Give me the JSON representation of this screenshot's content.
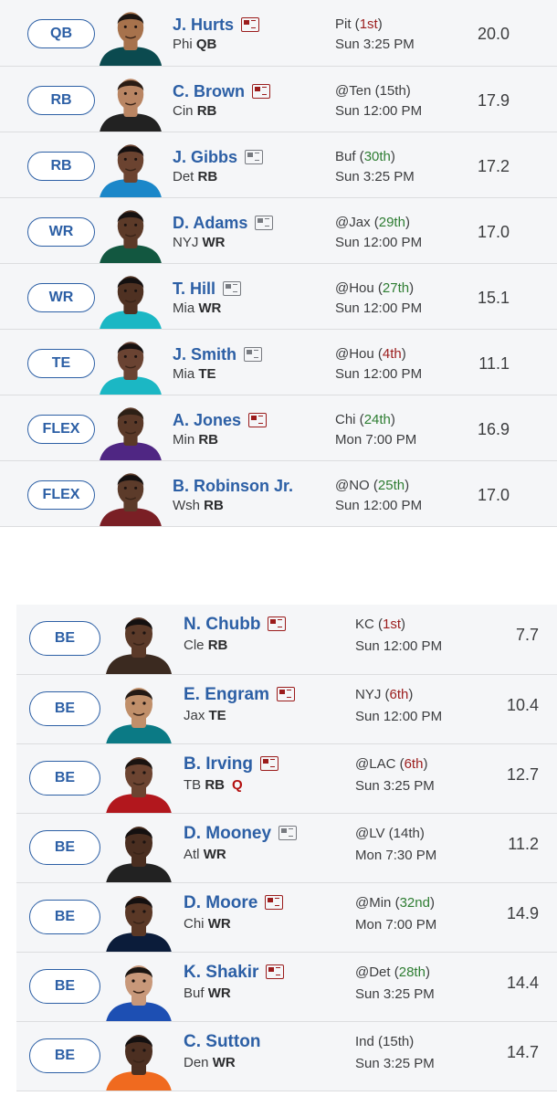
{
  "starters": [
    {
      "slot": "QB",
      "name": "J. Hurts",
      "news": "red",
      "team": "Phi",
      "pos": "QB",
      "injury": "",
      "opp": "Pit",
      "rank": "1st",
      "rank_color": "bad",
      "time": "Sun 3:25 PM",
      "proj": "20.0",
      "skin": "#a7724c",
      "hair": "#1c1512",
      "jersey": "#0b4a4f"
    },
    {
      "slot": "RB",
      "name": "C. Brown",
      "news": "red",
      "team": "Cin",
      "pos": "RB",
      "injury": "",
      "opp": "@Ten",
      "rank": "15th",
      "rank_color": "neutral",
      "time": "Sun 12:00 PM",
      "proj": "17.9",
      "skin": "#b98563",
      "hair": "#2a1c14",
      "jersey": "#222222"
    },
    {
      "slot": "RB",
      "name": "J. Gibbs",
      "news": "grey",
      "team": "Det",
      "pos": "RB",
      "injury": "",
      "opp": "Buf",
      "rank": "30th",
      "rank_color": "good",
      "time": "Sun 3:25 PM",
      "proj": "17.2",
      "skin": "#6b4330",
      "hair": "#151010",
      "jersey": "#1b87c9"
    },
    {
      "slot": "WR",
      "name": "D. Adams",
      "news": "grey",
      "team": "NYJ",
      "pos": "WR",
      "injury": "",
      "opp": "@Jax",
      "rank": "29th",
      "rank_color": "good",
      "time": "Sun 12:00 PM",
      "proj": "17.0",
      "skin": "#5c3a28",
      "hair": "#161111",
      "jersey": "#125740"
    },
    {
      "slot": "WR",
      "name": "T. Hill",
      "news": "grey",
      "team": "Mia",
      "pos": "WR",
      "injury": "",
      "opp": "@Hou",
      "rank": "27th",
      "rank_color": "good",
      "time": "Sun 12:00 PM",
      "proj": "15.1",
      "skin": "#4f3122",
      "hair": "#141010",
      "jersey": "#1bb7c4"
    },
    {
      "slot": "TE",
      "name": "J. Smith",
      "news": "grey",
      "team": "Mia",
      "pos": "TE",
      "injury": "",
      "opp": "@Hou",
      "rank": "4th",
      "rank_color": "bad",
      "time": "Sun 12:00 PM",
      "proj": "11.1",
      "skin": "#6a4332",
      "hair": "#161111",
      "jersey": "#1bb7c4"
    },
    {
      "slot": "FLEX",
      "name": "A. Jones",
      "news": "red",
      "team": "Min",
      "pos": "RB",
      "injury": "",
      "opp": "Chi",
      "rank": "24th",
      "rank_color": "good",
      "time": "Mon 7:00 PM",
      "proj": "16.9",
      "skin": "#5a3928",
      "hair": "#2c2016",
      "jersey": "#4f2683"
    },
    {
      "slot": "FLEX",
      "name": "B. Robinson Jr.",
      "news": "",
      "team": "Wsh",
      "pos": "RB",
      "injury": "",
      "opp": "@NO",
      "rank": "25th",
      "rank_color": "good",
      "time": "Sun 12:00 PM",
      "proj": "17.0",
      "skin": "#5c3b2a",
      "hair": "#141010",
      "jersey": "#7a1f25"
    }
  ],
  "bench": [
    {
      "slot": "BE",
      "name": "N. Chubb",
      "news": "red",
      "team": "Cle",
      "pos": "RB",
      "injury": "",
      "opp": "KC",
      "rank": "1st",
      "rank_color": "bad",
      "time": "Sun 12:00 PM",
      "proj": "7.7",
      "skin": "#5b3a29",
      "hair": "#141010",
      "jersey": "#3b2a20"
    },
    {
      "slot": "BE",
      "name": "E. Engram",
      "news": "red",
      "team": "Jax",
      "pos": "TE",
      "injury": "",
      "opp": "NYJ",
      "rank": "6th",
      "rank_color": "bad",
      "time": "Sun 12:00 PM",
      "proj": "10.4",
      "skin": "#c08f6a",
      "hair": "#231914",
      "jersey": "#0b7a85"
    },
    {
      "slot": "BE",
      "name": "B. Irving",
      "news": "red",
      "team": "TB",
      "pos": "RB",
      "injury": "Q",
      "opp": "@LAC",
      "rank": "6th",
      "rank_color": "bad",
      "time": "Sun 3:25 PM",
      "proj": "12.7",
      "skin": "#6c4431",
      "hair": "#1a1310",
      "jersey": "#b2171d"
    },
    {
      "slot": "BE",
      "name": "D. Mooney",
      "news": "grey",
      "team": "Atl",
      "pos": "WR",
      "injury": "",
      "opp": "@LV",
      "rank": "14th",
      "rank_color": "neutral",
      "time": "Mon 7:30 PM",
      "proj": "11.2",
      "skin": "#4a2e20",
      "hair": "#141010",
      "jersey": "#222222"
    },
    {
      "slot": "BE",
      "name": "D. Moore",
      "news": "red",
      "team": "Chi",
      "pos": "WR",
      "injury": "",
      "opp": "@Min",
      "rank": "32nd",
      "rank_color": "good",
      "time": "Mon 7:00 PM",
      "proj": "14.9",
      "skin": "#5a3826",
      "hair": "#141010",
      "jersey": "#0b1c3a"
    },
    {
      "slot": "BE",
      "name": "K. Shakir",
      "news": "red",
      "team": "Buf",
      "pos": "WR",
      "injury": "",
      "opp": "@Det",
      "rank": "28th",
      "rank_color": "good",
      "time": "Sun 3:25 PM",
      "proj": "14.4",
      "skin": "#c8987a",
      "hair": "#1b1512",
      "jersey": "#1d4fb3"
    },
    {
      "slot": "BE",
      "name": "C. Sutton",
      "news": "",
      "team": "Den",
      "pos": "WR",
      "injury": "",
      "opp": "Ind",
      "rank": "15th",
      "rank_color": "neutral",
      "time": "Sun 3:25 PM",
      "proj": "14.7",
      "skin": "#4c2f21",
      "hair": "#141010",
      "jersey": "#f06a1f"
    }
  ]
}
